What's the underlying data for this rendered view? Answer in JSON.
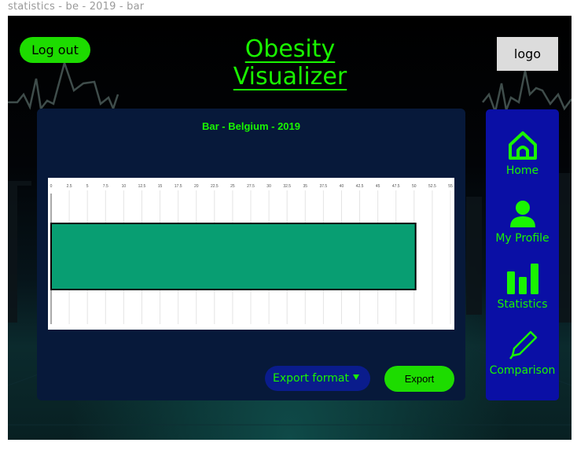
{
  "window": {
    "title": "statistics - be - 2019 - bar"
  },
  "header": {
    "logout_label": "Log out",
    "app_title": "Obesity Visualizer",
    "logo_label": "logo"
  },
  "sidebar": {
    "items": [
      {
        "label": "Home",
        "icon": "home-icon"
      },
      {
        "label": "My Profile",
        "icon": "user-icon"
      },
      {
        "label": "Statistics",
        "icon": "bar-chart-icon"
      },
      {
        "label": "Comparison",
        "icon": "pencil-icon"
      }
    ]
  },
  "export": {
    "format_label": "Export format",
    "button_label": "Export"
  },
  "colors": {
    "accent": "#19f500",
    "button_green": "#1ddc00",
    "panel": "#07193a",
    "sidebar": "#0a0fa5",
    "bar": "#089e72"
  },
  "chart_data": {
    "type": "bar",
    "orientation": "horizontal",
    "title": "Bar - Belgium - 2019",
    "categories": [
      ""
    ],
    "values": [
      50.2
    ],
    "xlim": [
      0,
      55
    ],
    "ticks": [
      "0",
      "2.5",
      "5",
      "7.5",
      "10",
      "12.5",
      "15",
      "17.5",
      "20",
      "22.5",
      "25",
      "27.5",
      "30",
      "32.5",
      "35",
      "37.5",
      "40",
      "42.5",
      "45",
      "47.5",
      "50",
      "52.5",
      "55"
    ],
    "grid": true,
    "xlabel": "",
    "ylabel": ""
  }
}
